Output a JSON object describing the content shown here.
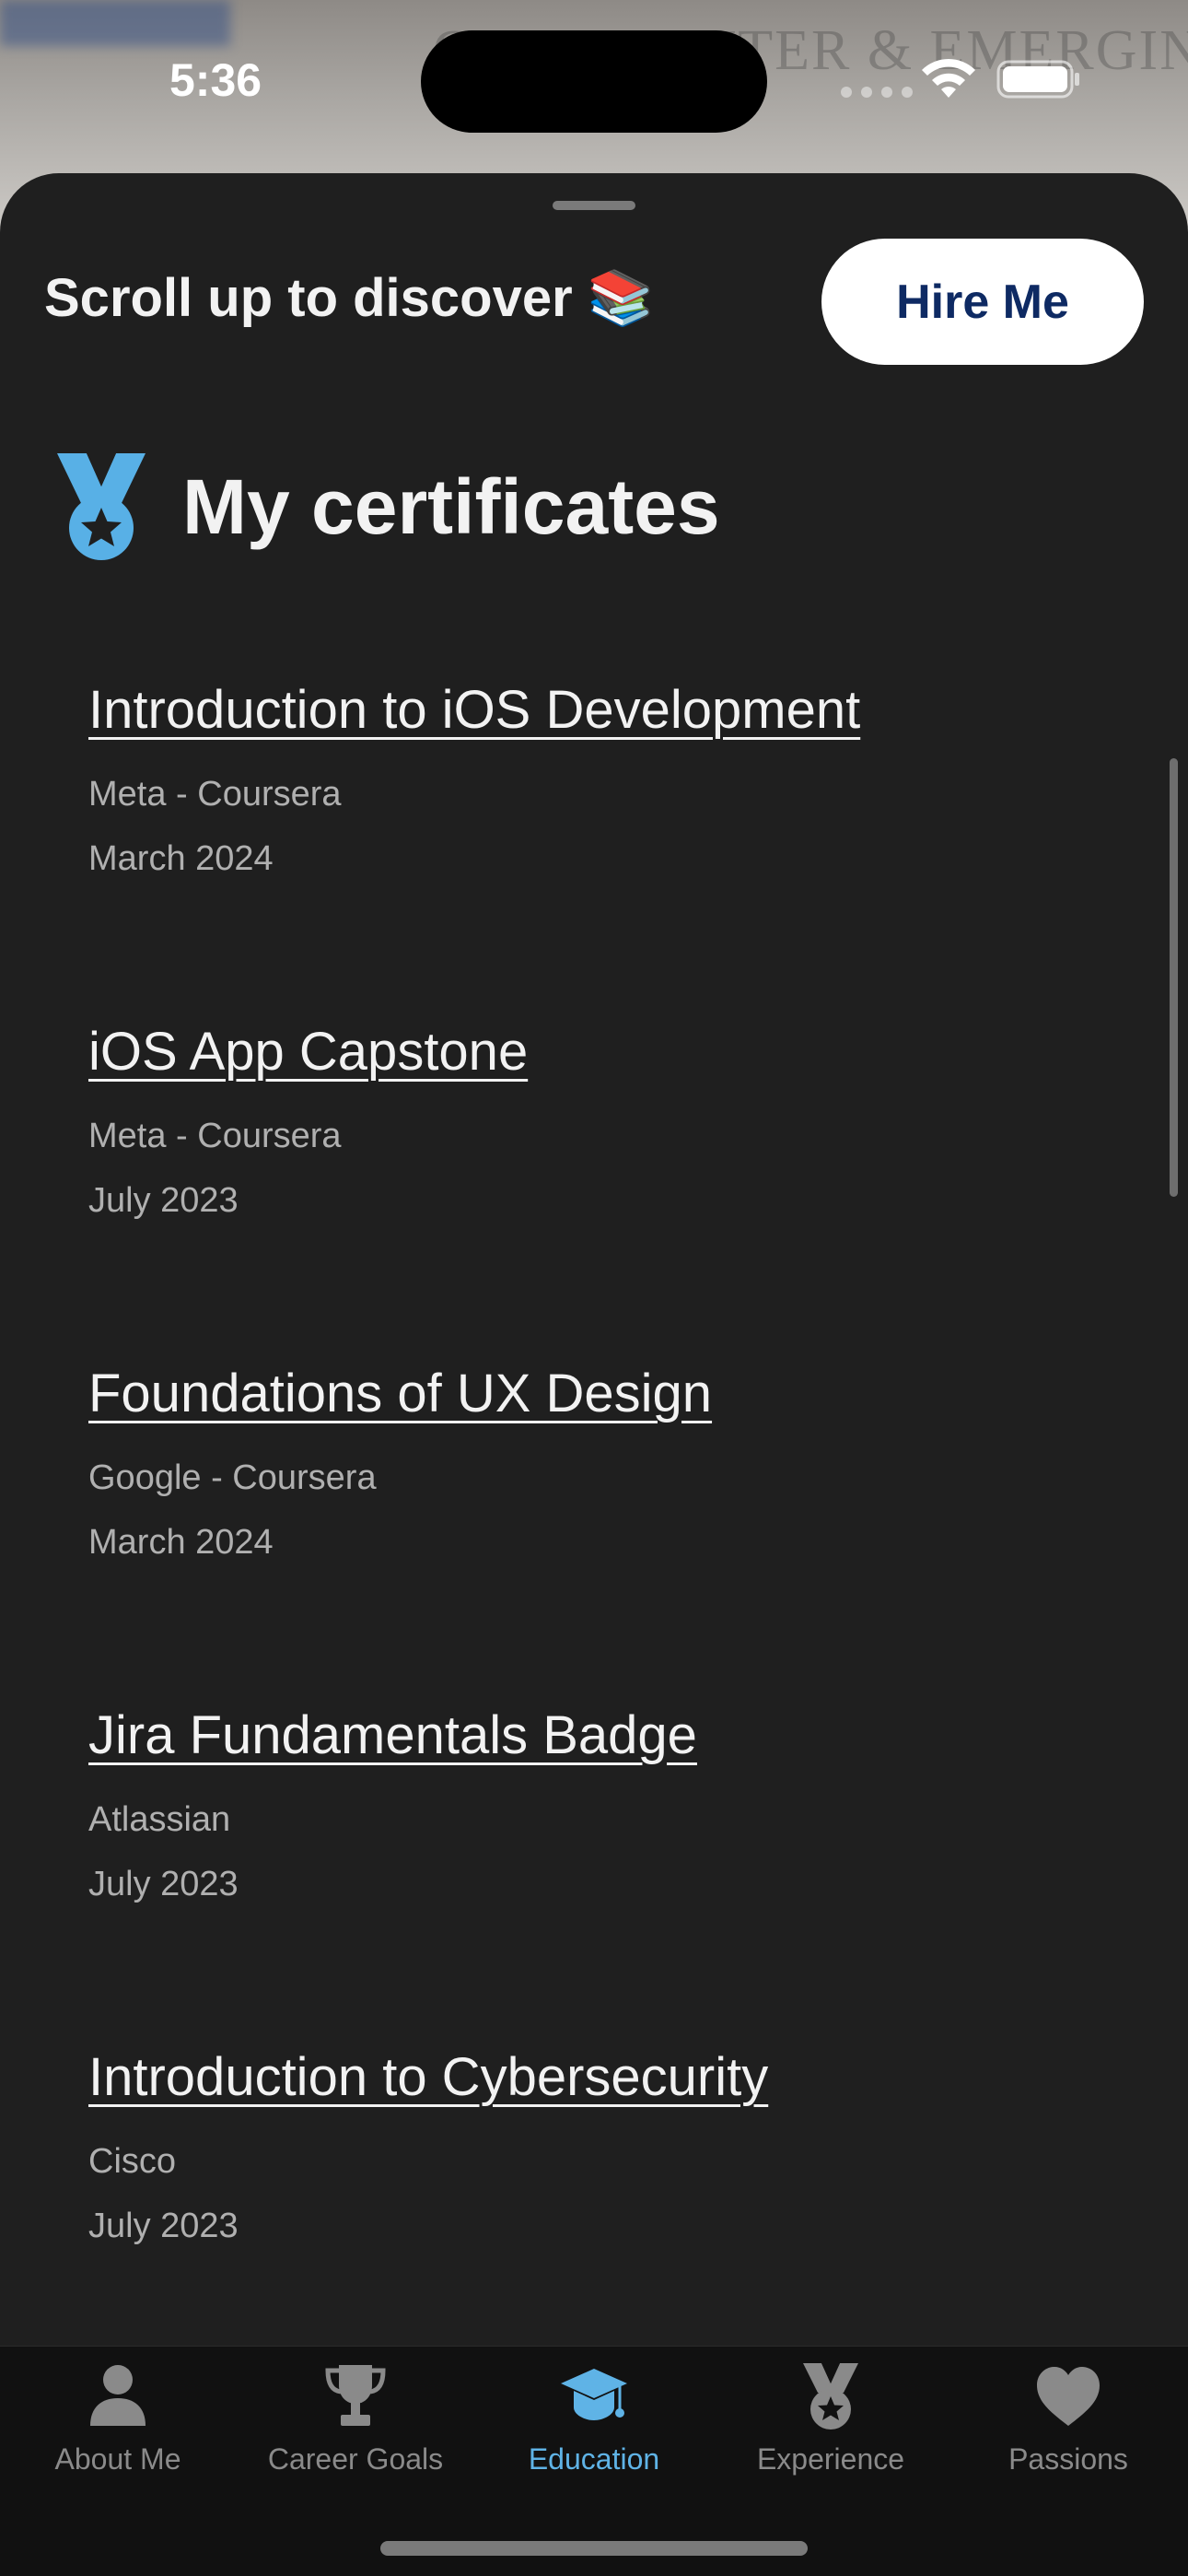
{
  "status_bar": {
    "time": "5:36",
    "icons": [
      "wifi-icon",
      "battery-icon"
    ]
  },
  "background": {
    "ghost_text": "CE COMPUTER & EMERGIN"
  },
  "sheet": {
    "discover_text": "Scroll up to discover 📚",
    "hire_button_label": "Hire Me"
  },
  "certificates": {
    "icon": "medal-icon",
    "title": "My certificates",
    "items": [
      {
        "title": "Introduction to iOS Development",
        "issuer": "Meta - Coursera",
        "date": "March 2024"
      },
      {
        "title": "iOS App Capstone",
        "issuer": "Meta - Coursera",
        "date": "July 2023"
      },
      {
        "title": "Foundations of UX Design",
        "issuer": "Google - Coursera",
        "date": "March 2024"
      },
      {
        "title": "Jira Fundamentals Badge",
        "issuer": "Atlassian",
        "date": "July 2023"
      },
      {
        "title": "Introduction to Cybersecurity",
        "issuer": "Cisco",
        "date": "July 2023"
      }
    ]
  },
  "tab_bar": {
    "active_tab": "Education",
    "tabs": [
      {
        "label": "About Me",
        "icon": "person-icon"
      },
      {
        "label": "Career Goals",
        "icon": "trophy-icon"
      },
      {
        "label": "Education",
        "icon": "graduation-cap-icon"
      },
      {
        "label": "Experience",
        "icon": "medal-icon"
      },
      {
        "label": "Passions",
        "icon": "heart-icon"
      }
    ]
  },
  "colors": {
    "sheet_background": "#1f1f1f",
    "accent": "#5fb3e6",
    "hire_button_text": "#0e2a63",
    "inactive_tab": "#8a8a8a"
  }
}
